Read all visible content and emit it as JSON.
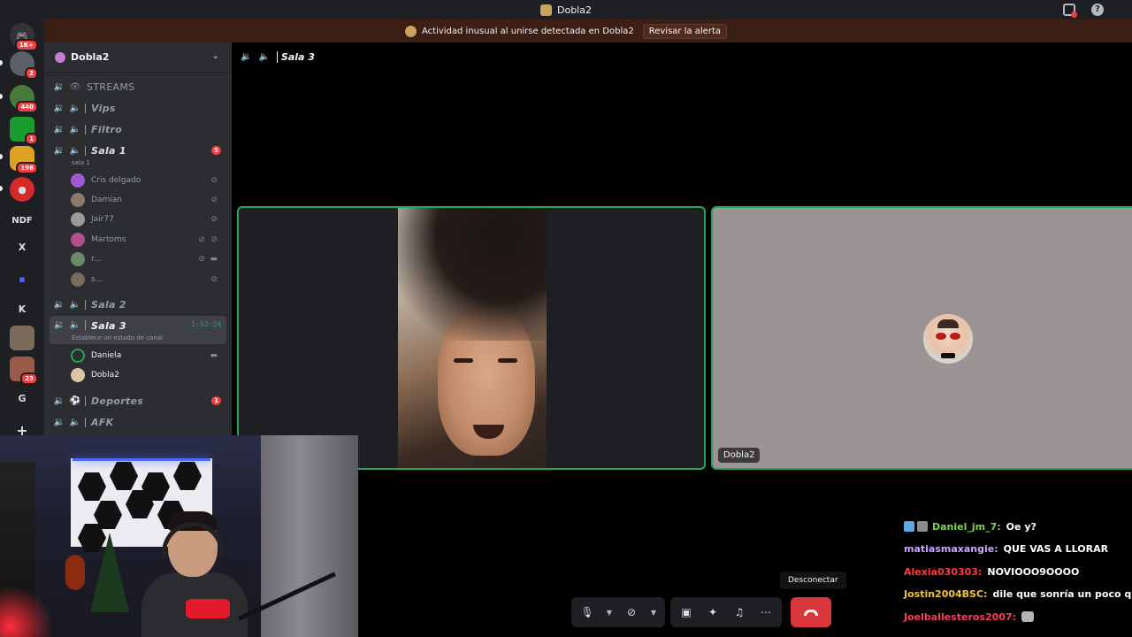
{
  "window": {
    "title": "Dobla2"
  },
  "alert": {
    "text": "Actividad inusual al unirse detectada en Dobla2",
    "button": "Revisar la alerta"
  },
  "rail": {
    "servers": [
      {
        "label": "",
        "badge": "1K+",
        "color": "#313338"
      },
      {
        "label": "",
        "badge": "2",
        "color": "#5b5f66"
      },
      {
        "label": "",
        "badge": "440",
        "color": "#4a7a3a"
      },
      {
        "label": "",
        "badge": "1",
        "color": "#1b9c2e"
      },
      {
        "label": "",
        "badge": "198",
        "color": "#e0a020"
      },
      {
        "label": "",
        "badge": "",
        "color": "#d42a2a"
      },
      {
        "label": "NDF",
        "badge": "",
        "color": "#1e1f22"
      },
      {
        "label": "X",
        "badge": "",
        "color": "#1e1f22"
      },
      {
        "label": "",
        "badge": "",
        "color": "#1e1f22"
      },
      {
        "label": "K",
        "badge": "",
        "color": "#1e1f22"
      },
      {
        "label": "",
        "badge": "",
        "color": "#7a6a5a"
      },
      {
        "label": "",
        "badge": "23",
        "color": "#9a5a4a"
      },
      {
        "label": "G",
        "badge": "",
        "color": "#1e1f22"
      },
      {
        "label": "+",
        "badge": "",
        "color": "#1e1f22"
      }
    ]
  },
  "sidebar": {
    "server_name": "Dobla2",
    "channels": {
      "streams": "STREAMS",
      "vips": "Vips",
      "filtro": "Filtro",
      "sala1": {
        "name": "Sala 1",
        "count": "5",
        "status": "sala 1"
      },
      "sala2": "Sala 2",
      "sala3": {
        "name": "Sala 3",
        "timer": "1:52:24",
        "status": "Establece un estado de canal"
      },
      "deportes": {
        "name": "Deportes",
        "count": "1"
      },
      "afk": "AFK"
    },
    "sala1_users": [
      "Cris delgado",
      "Damian",
      "Jair77",
      "Martoms",
      "r...",
      "s..."
    ],
    "sala3_users": [
      "Daniela",
      "Dobla2"
    ]
  },
  "call": {
    "channel_name": "Sala 3",
    "tile2_name": "Dobla2"
  },
  "chat": {
    "messages": [
      {
        "user": "Daniel_jm_7:",
        "text": "Oe y?",
        "color": "#7dd34a"
      },
      {
        "user": "matiasmaxangie:",
        "text": "QUE VAS A LLORAR",
        "color": "#c7a6ff"
      },
      {
        "user": "Alexia030303:",
        "text": "NOVIOOO9OOOO",
        "color": "#ff3b3b"
      },
      {
        "user": "Jostin2004BSC:",
        "text": "dile que sonría un poco que y",
        "color": "#f3c430"
      },
      {
        "user": "Joelballesteros2007:",
        "text": "",
        "color": "#ff3b5c"
      }
    ]
  },
  "controls": {
    "tooltip": "Desconectar"
  },
  "colors": {
    "speaking": "#23a55a",
    "danger": "#da373c",
    "sidebar_bg": "#2b2d31"
  }
}
